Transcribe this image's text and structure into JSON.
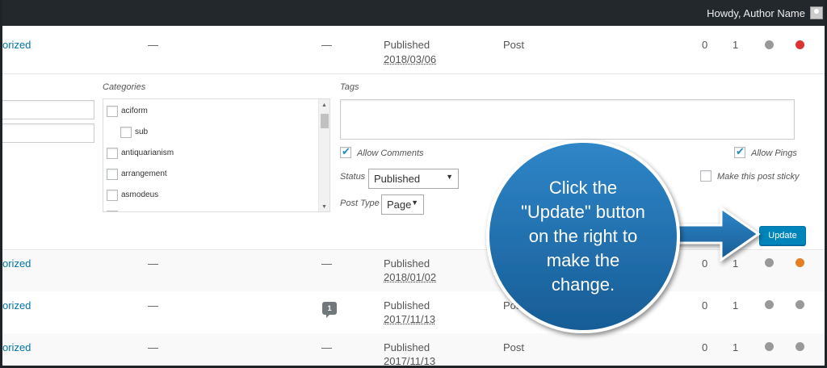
{
  "adminbar": {
    "greeting": "Howdy, Author Name"
  },
  "rows_top": {
    "category": "orized",
    "tags": "—",
    "comments_dash": "—",
    "status": "Published",
    "date": "2018/03/06",
    "type": "Post",
    "count_a": "0",
    "count_b": "1",
    "status_dot_color": "#dc3232"
  },
  "editor": {
    "categories_label": "Categories",
    "tags_label": "Tags",
    "categories": [
      {
        "name": "aciform",
        "child": false
      },
      {
        "name": "sub",
        "child": true
      },
      {
        "name": "antiquarianism",
        "child": false
      },
      {
        "name": "arrangement",
        "child": false
      },
      {
        "name": "asmodeus",
        "child": false
      }
    ],
    "allow_comments": "Allow Comments",
    "allow_pings": "Allow Pings",
    "status_label": "Status",
    "status_value": "Published",
    "sticky_label": "Make this post sticky",
    "post_type_label": "Post Type",
    "post_type_value": "Page",
    "update_button": "Update"
  },
  "rows": [
    {
      "category": "orized",
      "tags": "—",
      "comments": "—",
      "comment_count": "",
      "status": "Published",
      "date": "2018/01/02",
      "type": "",
      "count_a": "0",
      "count_b": "1",
      "dot_color": "#e67e22"
    },
    {
      "category": "orized",
      "tags": "—",
      "comments": "",
      "comment_count": "1",
      "status": "Published",
      "date": "2017/11/13",
      "type": "Post",
      "count_a": "0",
      "count_b": "1",
      "dot_color": "#999999"
    },
    {
      "category": "orized",
      "tags": "—",
      "comments": "—",
      "comment_count": "",
      "status": "Published",
      "date": "2017/11/13",
      "type": "Post",
      "count_a": "0",
      "count_b": "1",
      "dot_color": "#999999"
    }
  ],
  "callout": {
    "lines": [
      "Click the",
      "\"Update\" button",
      "on the right to",
      "make the",
      "change."
    ],
    "color": "#1f6fae"
  }
}
